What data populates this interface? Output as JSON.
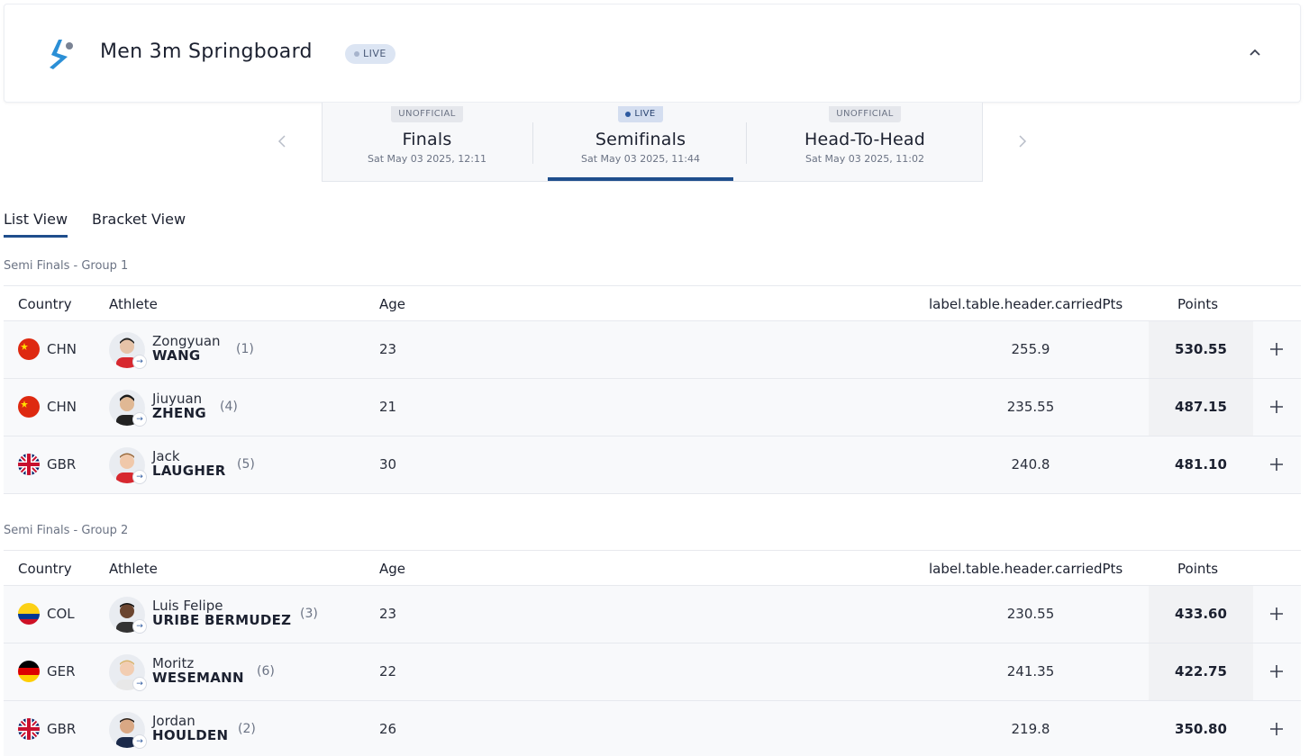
{
  "event": {
    "title": "Men 3m Springboard",
    "status_badge": "LIVE"
  },
  "phases": [
    {
      "status": "UNOFFICIAL",
      "name": "Finals",
      "date": "Sat May 03 2025, 12:11"
    },
    {
      "status": "LIVE",
      "name": "Semifinals",
      "date": "Sat May 03 2025, 11:44",
      "active": true
    },
    {
      "status": "UNOFFICIAL",
      "name": "Head-To-Head",
      "date": "Sat May 03 2025, 11:02"
    }
  ],
  "views": {
    "list": "List View",
    "bracket": "Bracket View",
    "active": "list"
  },
  "columns": {
    "country": "Country",
    "athlete": "Athlete",
    "age": "Age",
    "carried": "label.table.header.carriedPts",
    "points": "Points"
  },
  "groups": [
    {
      "title": "Semi Finals - Group 1",
      "rows": [
        {
          "country": "CHN",
          "first": "Zongyuan",
          "last": "WANG",
          "seed": "(1)",
          "age": "23",
          "carried": "255.9",
          "points": "530.55"
        },
        {
          "country": "CHN",
          "first": "Jiuyuan",
          "last": "ZHENG",
          "seed": "(4)",
          "age": "21",
          "carried": "235.55",
          "points": "487.15"
        },
        {
          "country": "GBR",
          "first": "Jack",
          "last": "LAUGHER",
          "seed": "(5)",
          "age": "30",
          "carried": "240.8",
          "points": "481.10"
        }
      ]
    },
    {
      "title": "Semi Finals - Group 2",
      "rows": [
        {
          "country": "COL",
          "first": "Luis Felipe",
          "last": "URIBE BERMUDEZ",
          "seed": "(3)",
          "age": "23",
          "carried": "230.55",
          "points": "433.60"
        },
        {
          "country": "GER",
          "first": "Moritz",
          "last": "WESEMANN",
          "seed": "(6)",
          "age": "22",
          "carried": "241.35",
          "points": "422.75"
        },
        {
          "country": "GBR",
          "first": "Jordan",
          "last": "HOULDEN",
          "seed": "(2)",
          "age": "26",
          "carried": "219.8",
          "points": "350.80"
        }
      ]
    }
  ],
  "colors": {
    "accent": "#1f4e8c",
    "icon_blue": "#2b8fd6",
    "badge_bg": "#dce5f3"
  }
}
